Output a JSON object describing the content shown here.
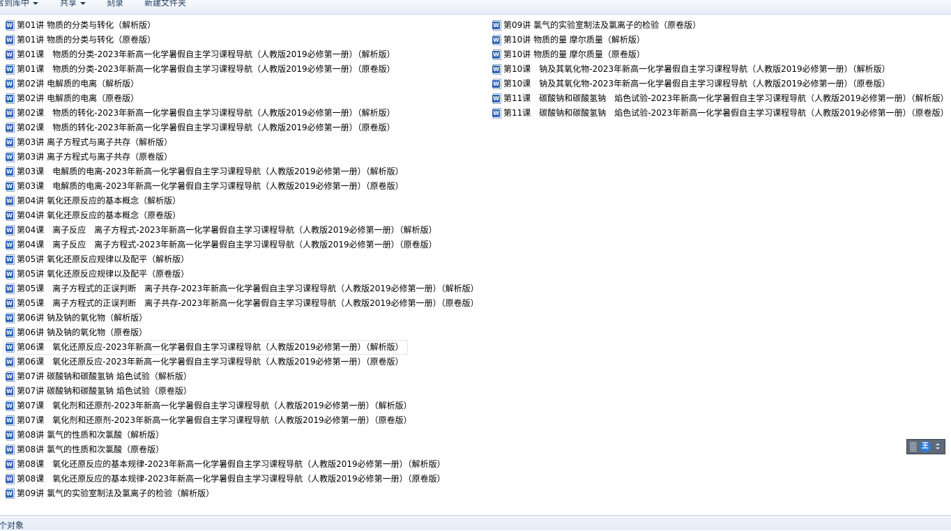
{
  "toolbar": {
    "include_in_library": "含到库中",
    "share": "共享",
    "burn": "刻录",
    "new_folder": "新建文件夹"
  },
  "icon": {
    "file_icon": "word-document-icon",
    "file_icon_letter": "W",
    "file_icon_color": "#2f62b5"
  },
  "files_left": [
    "第01讲 物质的分类与转化（解析版）",
    "第01讲 物质的分类与转化（原卷版）",
    "第01课　物质的分类-2023年新高一化学暑假自主学习课程导航（人教版2019必修第一册）（解析版）",
    "第01课　物质的分类-2023年新高一化学暑假自主学习课程导航（人教版2019必修第一册）（原卷版）",
    "第02讲 电解质的电离（解析版）",
    "第02讲 电解质的电离（原卷版）",
    "第02课　物质的转化-2023年新高一化学暑假自主学习课程导航（人教版2019必修第一册）（解析版）",
    "第02课　物质的转化-2023年新高一化学暑假自主学习课程导航（人教版2019必修第一册）（原卷版）",
    "第03讲 离子方程式与离子共存（解析版）",
    "第03讲 离子方程式与离子共存（原卷版）",
    "第03课　电解质的电离-2023年新高一化学暑假自主学习课程导航（人教版2019必修第一册）（解析版）",
    "第03课　电解质的电离-2023年新高一化学暑假自主学习课程导航（人教版2019必修第一册）（原卷版）",
    "第04讲 氧化还原反应的基本概念（解析版）",
    "第04讲 氧化还原反应的基本概念（原卷版）",
    "第04课　离子反应　离子方程式-2023年新高一化学暑假自主学习课程导航（人教版2019必修第一册）（解析版）",
    "第04课　离子反应　离子方程式-2023年新高一化学暑假自主学习课程导航（人教版2019必修第一册）（原卷版）",
    "第05讲 氧化还原反应规律以及配平（解析版）",
    "第05讲 氧化还原反应规律以及配平（原卷版）",
    "第05课　离子方程式的正误判断　离子共存-2023年新高一化学暑假自主学习课程导航（人教版2019必修第一册）（解析版）",
    "第05课　离子方程式的正误判断　离子共存-2023年新高一化学暑假自主学习课程导航（人教版2019必修第一册）（原卷版）",
    "第06讲 钠及钠的氧化物（解析版）",
    "第06讲 钠及钠的氧化物（原卷版）",
    "第06课　氧化还原反应-2023年新高一化学暑假自主学习课程导航（人教版2019必修第一册）（解析版）",
    "第06课　氧化还原反应-2023年新高一化学暑假自主学习课程导航（人教版2019必修第一册）（原卷版）",
    "第07讲 碳酸钠和碳酸氢钠 焰色试验（解析版）",
    "第07讲 碳酸钠和碳酸氢钠 焰色试验（原卷版）",
    "第07课　氧化剂和还原剂-2023年新高一化学暑假自主学习课程导航（人教版2019必修第一册）（解析版）",
    "第07课　氧化剂和还原剂-2023年新高一化学暑假自主学习课程导航（人教版2019必修第一册）（原卷版）",
    "第08讲 氯气的性质和次氯酸（解析版）",
    "第08讲 氯气的性质和次氯酸（原卷版）",
    "第08课　氧化还原反应的基本规律-2023年新高一化学暑假自主学习课程导航（人教版2019必修第一册）（解析版）",
    "第08课　氧化还原反应的基本规律-2023年新高一化学暑假自主学习课程导航（人教版2019必修第一册）（原卷版）",
    "第09讲 氯气的实验室制法及氯离子的检验（解析版）"
  ],
  "files_right": [
    "第09讲 氯气的实验室制法及氯离子的检验（原卷版）",
    "第10讲 物质的量 摩尔质量（解析版）",
    "第10讲 物质的量 摩尔质量（原卷版）",
    "第10课　钠及其氧化物-2023年新高一化学暑假自主学习课程导航（人教版2019必修第一册）（解析版）",
    "第10课　钠及其氧化物-2023年新高一化学暑假自主学习课程导航（人教版2019必修第一册）（原卷版）",
    "第11课　碳酸钠和碳酸氢钠　焰色试验-2023年新高一化学暑假自主学习课程导航（人教版2019必修第一册）（解析版）",
    "第11课　碳酸钠和碳酸氢钠　焰色试验-2023年新高一化学暑假自主学习课程导航（人教版2019必修第一册）（原卷版）"
  ],
  "statusbar": {
    "text": "个对象"
  },
  "ime": {
    "logo_glyph": "王"
  }
}
